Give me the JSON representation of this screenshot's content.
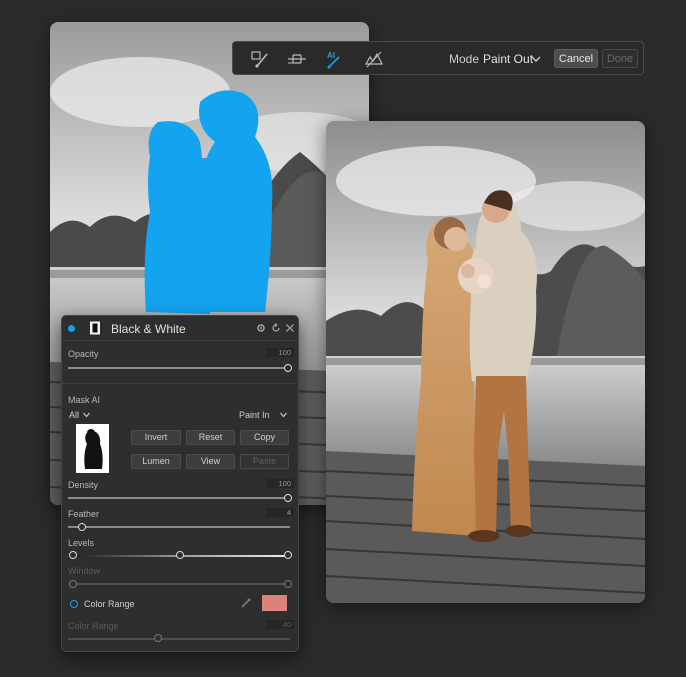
{
  "toolbar": {
    "tools": [
      "brush-tool",
      "gradient-tool",
      "ai-mask-tool",
      "luminosity-tool"
    ],
    "mode_label": "Mode",
    "mode_value": "Paint Out",
    "cancel_label": "Cancel",
    "done_label": "Done"
  },
  "panel": {
    "title": "Black & White",
    "opacity": {
      "label": "Opacity",
      "value": "100"
    },
    "mask_ai": {
      "label": "Mask AI",
      "scope_value": "All",
      "mode_value": "Paint In",
      "buttons": {
        "invert": "Invert",
        "reset": "Reset",
        "copy": "Copy",
        "lumen": "Lumen",
        "view": "View",
        "paste": "Paste"
      }
    },
    "density": {
      "label": "Density",
      "value": "100"
    },
    "feather": {
      "label": "Feather",
      "value": "4"
    },
    "levels": {
      "label": "Levels"
    },
    "window": {
      "label": "Window"
    },
    "color_range": {
      "label": "Color Range",
      "swatch_color": "#d9837b",
      "slider_label": "Color Range",
      "slider_value": "40"
    }
  },
  "colors": {
    "accent": "#1aa0e8",
    "mask_overlay": "#13a3ef",
    "background": "#2b2b2b"
  }
}
